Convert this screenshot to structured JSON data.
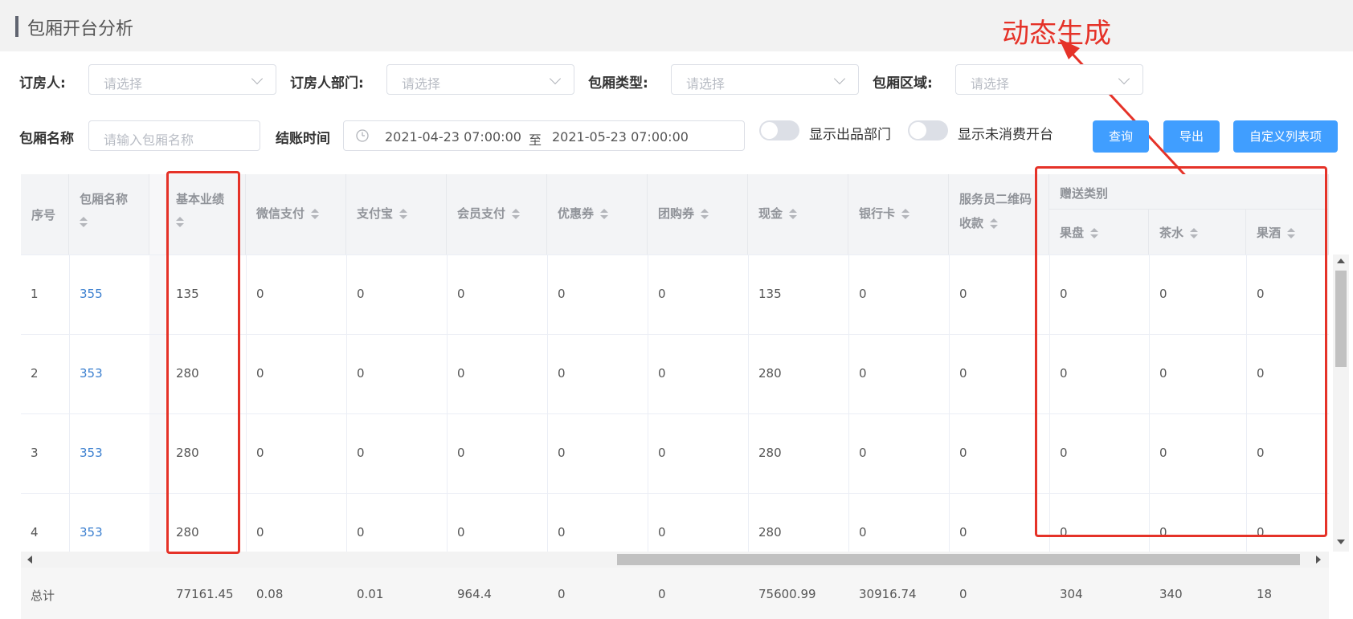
{
  "page_title": "包厢开台分析",
  "annotation": {
    "text": "动态生成"
  },
  "filters": {
    "booker_label": "订房人:",
    "booker_dept_label": "订房人部门:",
    "room_type_label": "包厢类型:",
    "room_area_label": "包厢区域:",
    "select_placeholder": "请选择",
    "room_name_label": "包厢名称",
    "room_name_placeholder": "请输入包厢名称",
    "checkout_time_label": "结账时间",
    "date_start": "2021-04-23 07:00:00",
    "date_sep": "至",
    "date_end": "2021-05-23 07:00:00",
    "toggle_dept_label": "显示出品部门",
    "toggle_unconsumed_label": "显示未消费开台",
    "toggle_dept_on": false,
    "toggle_unconsumed_on": false
  },
  "buttons": {
    "query": "查询",
    "export": "导出",
    "custom_columns": "自定义列表项"
  },
  "table": {
    "headers": {
      "index": "序号",
      "room_name": "包厢名称",
      "base": "基本业绩",
      "wechat": "微信支付",
      "alipay": "支付宝",
      "member": "会员支付",
      "coupon": "优惠券",
      "group": "团购券",
      "cash": "现金",
      "bank": "银行卡",
      "waiter_qr_1": "服务员二维码",
      "waiter_qr_2": "收款",
      "gift_group": "赠送类别",
      "fruit": "果盘",
      "tea": "茶水",
      "wine": "果酒"
    },
    "rows": [
      {
        "index": "1",
        "room": "355",
        "base": "135",
        "wechat": "0",
        "alipay": "0",
        "member": "0",
        "coupon": "0",
        "group": "0",
        "cash": "135",
        "bank": "0",
        "qr": "0",
        "fruit": "0",
        "tea": "0",
        "wine": "0"
      },
      {
        "index": "2",
        "room": "353",
        "base": "280",
        "wechat": "0",
        "alipay": "0",
        "member": "0",
        "coupon": "0",
        "group": "0",
        "cash": "280",
        "bank": "0",
        "qr": "0",
        "fruit": "0",
        "tea": "0",
        "wine": "0"
      },
      {
        "index": "3",
        "room": "353",
        "base": "280",
        "wechat": "0",
        "alipay": "0",
        "member": "0",
        "coupon": "0",
        "group": "0",
        "cash": "280",
        "bank": "0",
        "qr": "0",
        "fruit": "0",
        "tea": "0",
        "wine": "0"
      },
      {
        "index": "4",
        "room": "353",
        "base": "280",
        "wechat": "0",
        "alipay": "0",
        "member": "0",
        "coupon": "0",
        "group": "0",
        "cash": "280",
        "bank": "0",
        "qr": "0",
        "fruit": "0",
        "tea": "0",
        "wine": "0"
      }
    ],
    "total": {
      "label": "总计",
      "base": "77161.45",
      "wechat": "0.08",
      "alipay": "0.01",
      "member": "964.4",
      "coupon": "0",
      "group": "0",
      "cash": "75600.99",
      "bank": "30916.74",
      "qr": "0",
      "fruit": "304",
      "tea": "340",
      "wine": "18"
    }
  },
  "colors": {
    "accent": "#409eff",
    "annotation": "#e53228",
    "link": "#3b7fcf"
  }
}
